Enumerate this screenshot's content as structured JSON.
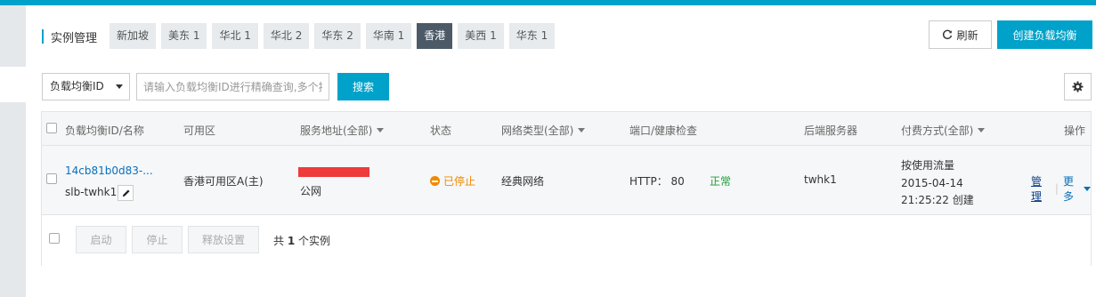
{
  "header": {
    "title": "实例管理",
    "accent_color": "#00a2ca",
    "tabs": [
      {
        "label": "新加坡",
        "active": false
      },
      {
        "label": "美东 1",
        "active": false
      },
      {
        "label": "华北 1",
        "active": false
      },
      {
        "label": "华北 2",
        "active": false
      },
      {
        "label": "华东 2",
        "active": false
      },
      {
        "label": "华南 1",
        "active": false
      },
      {
        "label": "香港",
        "active": true
      },
      {
        "label": "美西 1",
        "active": false
      },
      {
        "label": "华东 1",
        "active": false
      }
    ],
    "refresh_label": "刷新",
    "refresh_icon": "refresh-icon",
    "create_label": "创建负载均衡"
  },
  "filter": {
    "select_value": "负载均衡ID",
    "search_placeholder": "请输入负载均衡ID进行精确查询,多个按",
    "search_label": "搜索",
    "settings_icon": "gear-icon"
  },
  "table": {
    "columns": {
      "name": "负载均衡ID/名称",
      "zone": "可用区",
      "address": "服务地址(全部)",
      "status": "状态",
      "network": "网络类型(全部)",
      "port": "端口/健康检查",
      "backend": "后端服务器",
      "billing": "付费方式(全部)",
      "actions": "操作"
    },
    "rows": [
      {
        "id": "14cb81b0d83-...",
        "name": "slb-twhk1",
        "zone": "香港可用区A(主)",
        "address_type": "公网",
        "status": "已停止",
        "network": "经典网络",
        "port": "HTTP： 80",
        "health": "正常",
        "backend": "twhk1",
        "billing": "按使用流量",
        "created_date": "2015-04-14",
        "created_time": "21:25:22 创建",
        "manage_label": "管理",
        "more_label": "更多"
      }
    ]
  },
  "footer": {
    "start_label": "启动",
    "stop_label": "停止",
    "release_label": "释放设置",
    "count_prefix": "共",
    "count_value": "1",
    "count_suffix": "个实例"
  }
}
